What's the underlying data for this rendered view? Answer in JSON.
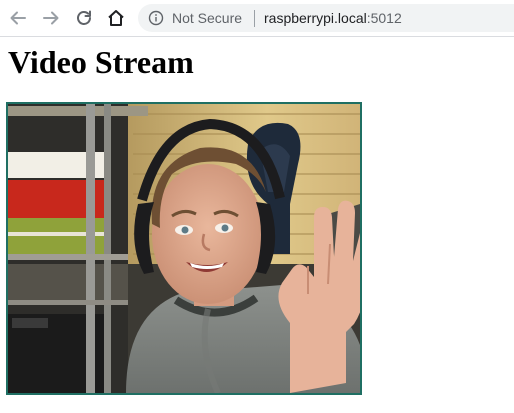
{
  "browser": {
    "security_label": "Not Secure",
    "url_host": "raspberrypi.local",
    "url_port": ":5012",
    "icons": [
      "back-arrow-icon",
      "forward-arrow-icon",
      "reload-icon",
      "home-icon",
      "info-icon"
    ]
  },
  "page": {
    "heading": "Video Stream"
  },
  "colors": {
    "frame_border": "#1f6f63",
    "toolbar_icon": "#5f6368",
    "omnibox_bg": "#f1f3f4"
  }
}
